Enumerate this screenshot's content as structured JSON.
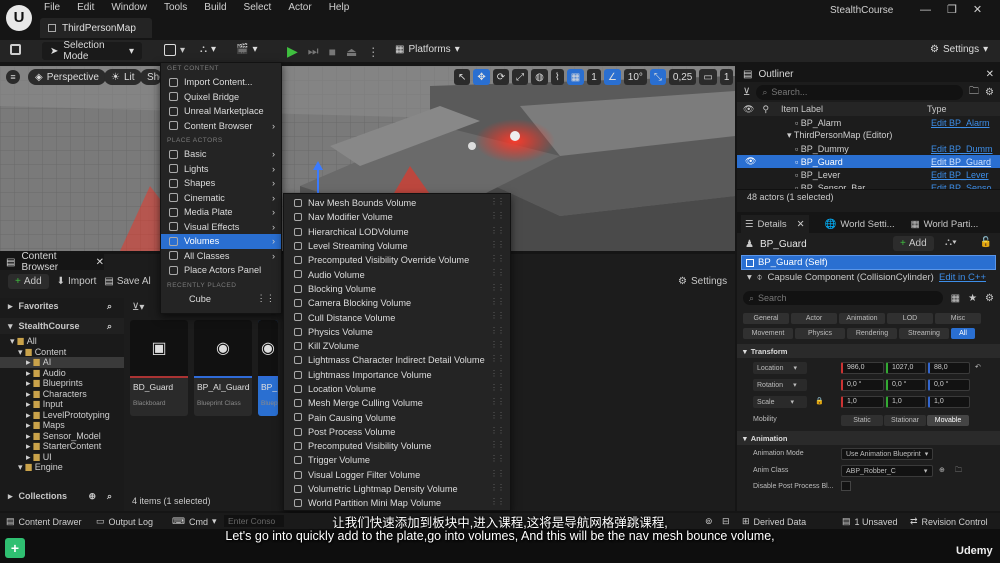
{
  "app": {
    "logo_glyph": "U",
    "menu": [
      "File",
      "Edit",
      "Window",
      "Tools",
      "Build",
      "Select",
      "Actor",
      "Help"
    ],
    "map_tab": "ThirdPersonMap",
    "project": "StealthCourse"
  },
  "toolbar": {
    "selection_mode": "Selection Mode",
    "platforms": "Platforms",
    "settings": "Settings"
  },
  "viewport": {
    "perspective": "Perspective",
    "lit": "Lit",
    "show": "Sho",
    "grid_value": "1",
    "angle_value": "10°",
    "scale_value": "0,25",
    "camera_value": "1"
  },
  "add_menu": {
    "header_get_content": "GET CONTENT",
    "get_content": [
      {
        "label": "Import Content...",
        "chevron": false
      },
      {
        "label": "Quixel Bridge",
        "chevron": false
      },
      {
        "label": "Unreal Marketplace",
        "chevron": false
      },
      {
        "label": "Content Browser",
        "chevron": true
      }
    ],
    "header_place_actors": "PLACE ACTORS",
    "place_actors": [
      {
        "label": "Basic",
        "chevron": true
      },
      {
        "label": "Lights",
        "chevron": true
      },
      {
        "label": "Shapes",
        "chevron": true
      },
      {
        "label": "Cinematic",
        "chevron": true
      },
      {
        "label": "Media Plate",
        "chevron": true
      },
      {
        "label": "Visual Effects",
        "chevron": true
      },
      {
        "label": "Volumes",
        "chevron": true
      },
      {
        "label": "All Classes",
        "chevron": true
      },
      {
        "label": "Place Actors Panel",
        "chevron": false
      }
    ],
    "header_recent": "RECENTLY PLACED",
    "recent": [
      "Cube"
    ],
    "selected_index": 6
  },
  "volumes_menu": [
    "Nav Mesh Bounds Volume",
    "Nav Modifier Volume",
    "Hierarchical LODVolume",
    "Level Streaming Volume",
    "Precomputed Visibility Override Volume",
    "Audio Volume",
    "Blocking Volume",
    "Camera Blocking Volume",
    "Cull Distance Volume",
    "Physics Volume",
    "Kill ZVolume",
    "Lightmass Character Indirect Detail Volume",
    "Lightmass Importance Volume",
    "Location Volume",
    "Mesh Merge Culling Volume",
    "Pain Causing Volume",
    "Post Process Volume",
    "Precomputed Visibility Volume",
    "Trigger Volume",
    "Visual Logger Filter Volume",
    "Volumetric Lightmap Density Volume",
    "World Partition Mini Map Volume"
  ],
  "outliner": {
    "title": "Outliner",
    "search_placeholder": "Search...",
    "col_label": "Item Label",
    "col_type": "Type",
    "rows": [
      {
        "label": "BP_Alarm",
        "type": "Edit BP_Alarm",
        "selected": false
      },
      {
        "label": "ThirdPersonMap (Editor)",
        "type": "",
        "selected": false
      },
      {
        "label": "BP_Dummy",
        "type": "Edit BP_Dumm",
        "selected": false
      },
      {
        "label": "BP_Guard",
        "type": "Edit BP_Guard",
        "selected": true
      },
      {
        "label": "BP_Lever",
        "type": "Edit BP_Lever",
        "selected": false
      },
      {
        "label": "BP_Sensor_Bar",
        "type": "Edit BP_Senso",
        "selected": false
      }
    ],
    "count": "48 actors (1 selected)"
  },
  "details": {
    "tabs": [
      "Details",
      "World Setti...",
      "World Parti..."
    ],
    "actor": "BP_Guard",
    "add": "Add",
    "self": "BP_Guard (Self)",
    "component": "Capsule Component (CollisionCylinder)",
    "edit_cpp": "Edit in C++",
    "search_placeholder": "Search",
    "filters_row1": [
      "General",
      "Actor",
      "Animation",
      "LOD",
      "Misc"
    ],
    "filters_row2": [
      "Movement",
      "Physics",
      "Rendering",
      "Streaming",
      "All"
    ],
    "transform_header": "Transform",
    "location_label": "Location",
    "location": [
      "986,0",
      "1027,0",
      "88,0"
    ],
    "rotation_label": "Rotation",
    "rotation": [
      "0,0 °",
      "0,0 °",
      "0,0 °"
    ],
    "scale_label": "Scale",
    "scale": [
      "1,0",
      "1,0",
      "1,0"
    ],
    "mobility_label": "Mobility",
    "mobility": [
      "Static",
      "Stationar",
      "Movable"
    ],
    "animation_header": "Animation",
    "anim_mode_label": "Animation Mode",
    "anim_mode": "Use Animation Blueprint",
    "anim_class_label": "Anim Class",
    "anim_class": "ABP_Robber_C",
    "disable_pp_label": "Disable Post Process Bl..."
  },
  "content_browser": {
    "tab": "Content Browser",
    "add": "Add",
    "import": "Import",
    "save_all": "Save Al",
    "settings": "Settings",
    "favorites": "Favorites",
    "project": "StealthCourse",
    "tree": [
      {
        "label": "All",
        "depth": 0
      },
      {
        "label": "Content",
        "depth": 1
      },
      {
        "label": "AI",
        "depth": 2
      },
      {
        "label": "Audio",
        "depth": 2
      },
      {
        "label": "Blueprints",
        "depth": 2
      },
      {
        "label": "Characters",
        "depth": 2
      },
      {
        "label": "Input",
        "depth": 2
      },
      {
        "label": "LevelPrototyping",
        "depth": 2
      },
      {
        "label": "Maps",
        "depth": 2
      },
      {
        "label": "Sensor_Model",
        "depth": 2
      },
      {
        "label": "StarterContent",
        "depth": 2
      },
      {
        "label": "UI",
        "depth": 2
      },
      {
        "label": "Engine",
        "depth": 1
      }
    ],
    "collections": "Collections",
    "assets": [
      {
        "name": "BD_Guard",
        "type": "Blackboard"
      },
      {
        "name": "BP_AI_Guard",
        "type": "Blueprint Class"
      },
      {
        "name": "BP_",
        "type": "Bluepr"
      }
    ],
    "count": "4 items (1 selected)"
  },
  "statusbar": {
    "content_drawer": "Content Drawer",
    "output_log": "Output Log",
    "cmd": "Cmd",
    "console_placeholder": "Enter Conso",
    "derived_data": "Derived Data",
    "unsaved": "1 Unsaved",
    "revision": "Revision Control"
  },
  "subtitles": {
    "zh": "让我们快速添加到板块中,进入课程,这将是导航网格弹跳课程,",
    "en": "Let's go into quickly add to the plate,go into volumes, And this will be the nav mesh bounce volume,"
  },
  "watermark": "Udemy",
  "colors": {
    "accent": "#2a6fd1",
    "link": "#3d8ee8",
    "play": "#3fbf3f"
  }
}
